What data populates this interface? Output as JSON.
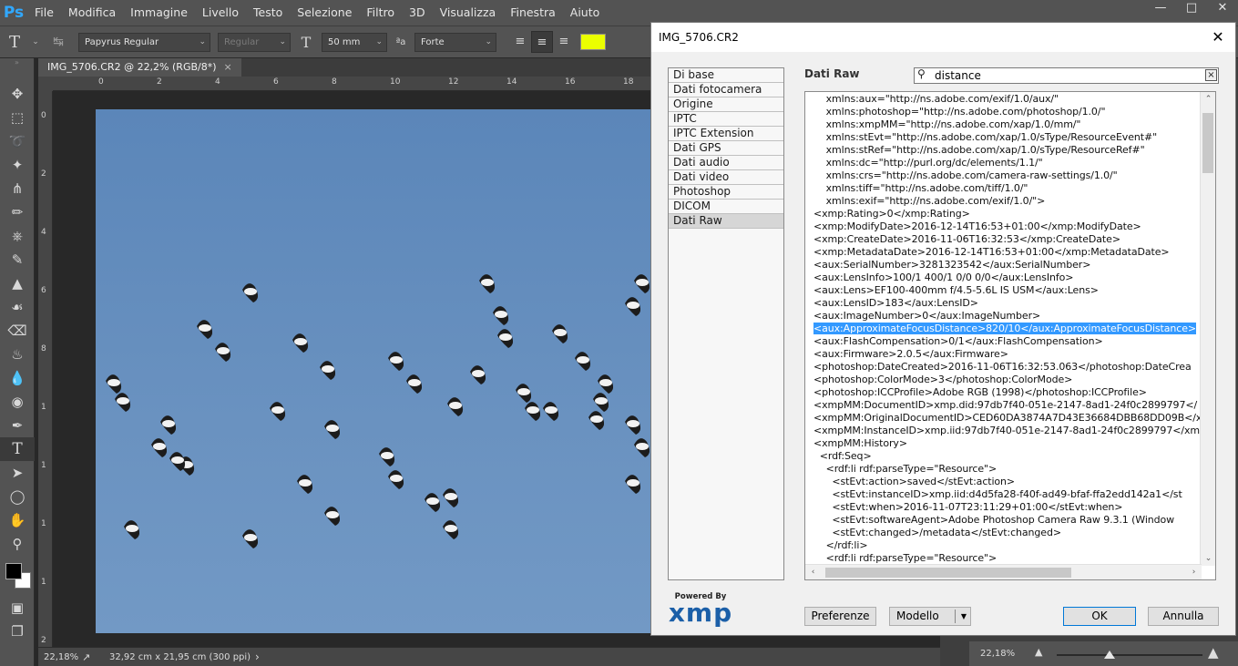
{
  "app": {
    "logo": "Ps",
    "menu": [
      "File",
      "Modifica",
      "Immagine",
      "Livello",
      "Testo",
      "Selezione",
      "Filtro",
      "3D",
      "Visualizza",
      "Finestra",
      "Aiuto"
    ],
    "window_controls": [
      "minimize",
      "maximize",
      "close"
    ]
  },
  "options_bar": {
    "tool_icon": "type-tool-icon",
    "font_family": "Papyrus Regular",
    "font_style": "Regular",
    "font_size": "50 mm",
    "antialias": "Forte",
    "text_color": "#ebff00"
  },
  "document_tab": {
    "label": "IMG_5706.CR2 @ 22,2% (RGB/8*)",
    "close": "×"
  },
  "rulers": {
    "h_labels": [
      "0",
      "2",
      "4",
      "6",
      "8",
      "10",
      "12",
      "14",
      "16",
      "18"
    ],
    "v_labels": [
      "0",
      "2",
      "4",
      "6",
      "8",
      "1",
      "1",
      "1",
      "1",
      "2"
    ]
  },
  "status_bar": {
    "zoom": "22,18%",
    "doc_size": "32,92 cm x 21,95 cm (300 ppi)",
    "arrow": "›"
  },
  "navigator": {
    "zoom": "22,18%"
  },
  "dialog": {
    "title": "IMG_5706.CR2",
    "categories": [
      "Di base",
      "Dati fotocamera",
      "Origine",
      "IPTC",
      "IPTC Extension",
      "Dati GPS",
      "Dati audio",
      "Dati video",
      "Photoshop",
      "DICOM",
      "Dati Raw"
    ],
    "selected_category": "Dati Raw",
    "section_title": "Dati Raw",
    "search": {
      "value": "distance",
      "clear": "×"
    },
    "raw_lines": [
      "    xmlns:aux=\"http://ns.adobe.com/exif/1.0/aux/\"",
      "    xmlns:photoshop=\"http://ns.adobe.com/photoshop/1.0/\"",
      "    xmlns:xmpMM=\"http://ns.adobe.com/xap/1.0/mm/\"",
      "    xmlns:stEvt=\"http://ns.adobe.com/xap/1.0/sType/ResourceEvent#\"",
      "    xmlns:stRef=\"http://ns.adobe.com/xap/1.0/sType/ResourceRef#\"",
      "    xmlns:dc=\"http://purl.org/dc/elements/1.1/\"",
      "    xmlns:crs=\"http://ns.adobe.com/camera-raw-settings/1.0/\"",
      "    xmlns:tiff=\"http://ns.adobe.com/tiff/1.0/\"",
      "    xmlns:exif=\"http://ns.adobe.com/exif/1.0/\">",
      "<xmp:Rating>0</xmp:Rating>",
      "<xmp:ModifyDate>2016-12-14T16:53+01:00</xmp:ModifyDate>",
      "<xmp:CreateDate>2016-11-06T16:32:53</xmp:CreateDate>",
      "<xmp:MetadataDate>2016-12-14T16:53+01:00</xmp:MetadataDate>",
      "<aux:SerialNumber>3281323542</aux:SerialNumber>",
      "<aux:LensInfo>100/1 400/1 0/0 0/0</aux:LensInfo>",
      "<aux:Lens>EF100-400mm f/4.5-5.6L IS USM</aux:Lens>",
      "<aux:LensID>183</aux:LensID>",
      "<aux:ImageNumber>0</aux:ImageNumber>",
      "<aux:ApproximateFocusDistance>820/10</aux:ApproximateFocusDistance>",
      "<aux:FlashCompensation>0/1</aux:FlashCompensation>",
      "<aux:Firmware>2.0.5</aux:Firmware>",
      "<photoshop:DateCreated>2016-11-06T16:32:53.063</photoshop:DateCrea",
      "<photoshop:ColorMode>3</photoshop:ColorMode>",
      "<photoshop:ICCProfile>Adobe RGB (1998)</photoshop:ICCProfile>",
      "<xmpMM:DocumentID>xmp.did:97db7f40-051e-2147-8ad1-24f0c2899797</",
      "<xmpMM:OriginalDocumentID>CED60DA3874A7D43E36684DBB68DD09B</x",
      "<xmpMM:InstanceID>xmp.iid:97db7f40-051e-2147-8ad1-24f0c2899797</xm",
      "<xmpMM:History>",
      "  <rdf:Seq>",
      "    <rdf:li rdf:parseType=\"Resource\">",
      "      <stEvt:action>saved</stEvt:action>",
      "      <stEvt:instanceID>xmp.iid:d4d5fa28-f40f-ad49-bfaf-ffa2edd142a1</st",
      "      <stEvt:when>2016-11-07T23:11:29+01:00</stEvt:when>",
      "      <stEvt:softwareAgent>Adobe Photoshop Camera Raw 9.3.1 (Window",
      "      <stEvt:changed>/metadata</stEvt:changed>",
      "    </rdf:li>",
      "    <rdf:li rdf:parseType=\"Resource\">"
    ],
    "highlighted_line": 18,
    "xmp_logo": {
      "powered_by": "Powered By",
      "word": "xmp"
    },
    "buttons": {
      "preferences": "Preferenze",
      "template": "Modello",
      "ok": "OK",
      "cancel": "Annulla"
    }
  }
}
